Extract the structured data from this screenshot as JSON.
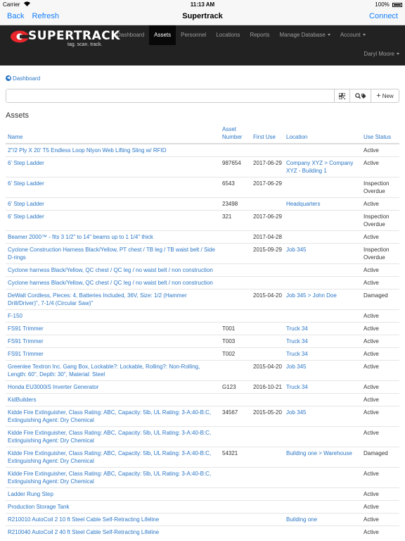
{
  "status_bar": {
    "carrier": "Carrier",
    "time": "11:13 AM",
    "battery": "100%"
  },
  "nav": {
    "back": "Back",
    "refresh": "Refresh",
    "title": "Supertrack",
    "connect": "Connect"
  },
  "brand": {
    "name": "SUPERTRACK",
    "tagline": "tag. scan. track.",
    "accent": "#e8262c"
  },
  "menu": [
    {
      "label": "Dashboard",
      "active": false,
      "dropdown": false
    },
    {
      "label": "Assets",
      "active": true,
      "dropdown": false
    },
    {
      "label": "Personnel",
      "active": false,
      "dropdown": false
    },
    {
      "label": "Locations",
      "active": false,
      "dropdown": false
    },
    {
      "label": "Reports",
      "active": false,
      "dropdown": false
    },
    {
      "label": "Manage Database",
      "active": false,
      "dropdown": true
    },
    {
      "label": "Account",
      "active": false,
      "dropdown": true
    }
  ],
  "user": {
    "name": "Daryl Moore"
  },
  "breadcrumb": {
    "label": "Dashboard"
  },
  "search": {
    "value": "",
    "placeholder": "",
    "new_label": "New"
  },
  "page_title": "Assets",
  "table": {
    "headers": [
      "Name",
      "Asset Number",
      "First Use",
      "Location",
      "Use Status"
    ],
    "rows": [
      [
        "2\"/2 Ply X 20' T5 Endless Loop Nlyon Web Lifting Sling w/ RFID",
        "",
        "",
        "",
        "Active"
      ],
      [
        "6' Step Ladder",
        "987654",
        "2017-06-29",
        "Company XYZ > Company XYZ - Building 1",
        "Active"
      ],
      [
        "6' Step Ladder",
        "6543",
        "2017-06-29",
        "",
        "Inspection Overdue"
      ],
      [
        "6' Step Ladder",
        "23498",
        "",
        "Headquarters",
        "Active"
      ],
      [
        "6' Step Ladder",
        "321",
        "2017-06-29",
        "",
        "Inspection Overdue"
      ],
      [
        "Beamer 2000™ - fits 3 1/2\" to 14\" beams up to 1 1/4\" thick",
        "",
        "2017-04-28",
        "",
        "Active"
      ],
      [
        "Cyclone Construction Harness Black/Yellow, PT chest / TB leg / TB waist belt / Side D-rings",
        "",
        "2015-09-29",
        "Job 345",
        "Inspection Overdue"
      ],
      [
        "Cyclone harness Black/Yellow, QC chest / QC leg / no waist belt / non construction",
        "",
        "",
        "",
        "Active"
      ],
      [
        "Cyclone harness Black/Yellow, QC chest / QC leg / no waist belt / non construction",
        "",
        "",
        "",
        "Active"
      ],
      [
        "DeWalt Cordless, Pieces: 4, Batteries Included, 36V, Size: 1/2 (Hammer Drill/Driver)\", 7-1/4 (Circular Saw)\"",
        "",
        "2015-04-20",
        "Job 345 > John Doe",
        "Damaged"
      ],
      [
        "F-150",
        "",
        "",
        "",
        "Active"
      ],
      [
        "FS91 Trimmer",
        "T001",
        "",
        "Truck 34",
        "Active"
      ],
      [
        "FS91 Trimmer",
        "T003",
        "",
        "Truck 34",
        "Active"
      ],
      [
        "FS91 Trimmer",
        "T002",
        "",
        "Truck 34",
        "Active"
      ],
      [
        "Greenlee Textron Inc. Gang Box, Lockable?: Lockable, Rolling?: Non-Rolling, Length: 60\", Depth: 30\", Material: Steel",
        "",
        "2015-04-20",
        "Job 345",
        "Active"
      ],
      [
        "Honda EU3000iS Inverter Generator",
        "G123",
        "2016-10-21",
        "Truck 34",
        "Active"
      ],
      [
        "KidBuilders",
        "",
        "",
        "",
        "Active"
      ],
      [
        "Kidde Fire Extinguisher, Class Rating: ABC, Capacity: 5lb, UL Rating: 3-A:40-B:C, Extinguishing Agent: Dry Chemical",
        "34567",
        "2015-05-20",
        "Job 345",
        "Active"
      ],
      [
        "Kidde Fire Extinguisher, Class Rating: ABC, Capacity: 5lb, UL Rating: 3-A:40-B:C, Extinguishing Agent: Dry Chemical",
        "",
        "",
        "",
        "Active"
      ],
      [
        "Kidde Fire Extinguisher, Class Rating: ABC, Capacity: 5lb, UL Rating: 3-A:40-B:C, Extinguishing Agent: Dry Chemical",
        "54321",
        "",
        "Building one > Warehouse",
        "Damaged"
      ],
      [
        "Kidde Fire Extinguisher, Class Rating: ABC, Capacity: 5lb, UL Rating: 3-A:40-B:C, Extinguishing Agent: Dry Chemical",
        "",
        "",
        "",
        "Active"
      ],
      [
        "Ladder Rung Step",
        "",
        "",
        "",
        "Active"
      ],
      [
        "Production Storage Tank",
        "",
        "",
        "",
        "Active"
      ],
      [
        "R210010 AutoCoil 2 10 ft Steel Cable Self-Retracting Lifeline",
        "",
        "",
        "Building one",
        "Active"
      ],
      [
        "R210040 AutoCoil 2 40 ft Steel Cable Self-Retracting Lifeline",
        "",
        "",
        "",
        "Active"
      ]
    ]
  }
}
